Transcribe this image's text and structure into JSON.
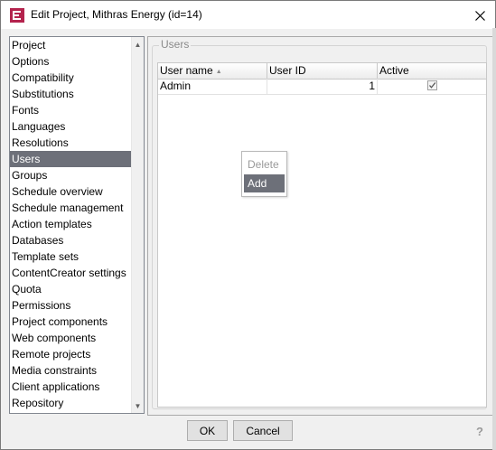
{
  "window": {
    "title": "Edit Project, Mithras Energy (id=14)",
    "icon": "firstspirit-app-icon",
    "close_icon": "close-icon"
  },
  "sidebar": {
    "items": [
      {
        "label": "Project"
      },
      {
        "label": "Options"
      },
      {
        "label": "Compatibility"
      },
      {
        "label": "Substitutions"
      },
      {
        "label": "Fonts"
      },
      {
        "label": "Languages"
      },
      {
        "label": "Resolutions"
      },
      {
        "label": "Users",
        "selected": true
      },
      {
        "label": "Groups"
      },
      {
        "label": "Schedule overview"
      },
      {
        "label": "Schedule management"
      },
      {
        "label": "Action templates"
      },
      {
        "label": "Databases"
      },
      {
        "label": "Template sets"
      },
      {
        "label": "ContentCreator settings"
      },
      {
        "label": "Quota"
      },
      {
        "label": "Permissions"
      },
      {
        "label": "Project components"
      },
      {
        "label": "Web components"
      },
      {
        "label": "Remote projects"
      },
      {
        "label": "Media constraints"
      },
      {
        "label": "Client applications"
      },
      {
        "label": "Repository"
      }
    ],
    "scroll_up_icon": "scroll-up-arrow-icon",
    "scroll_down_icon": "scroll-down-arrow-icon"
  },
  "users_panel": {
    "group_title": "Users",
    "columns": [
      {
        "label": "User name",
        "sort": "ascending"
      },
      {
        "label": "User ID"
      },
      {
        "label": "Active"
      }
    ],
    "rows": [
      {
        "user_name": "Admin",
        "user_id": "1",
        "active": true
      }
    ]
  },
  "context_menu": {
    "items": [
      {
        "label": "Delete",
        "enabled": false
      },
      {
        "label": "Add",
        "enabled": true,
        "highlighted": true
      }
    ]
  },
  "footer": {
    "ok_label": "OK",
    "cancel_label": "Cancel",
    "help_icon": "help-icon",
    "help_glyph": "?"
  },
  "colors": {
    "selection": "#6d7079",
    "dialog_background": "#f0f0f0",
    "icon_brand": "#b4234d"
  }
}
